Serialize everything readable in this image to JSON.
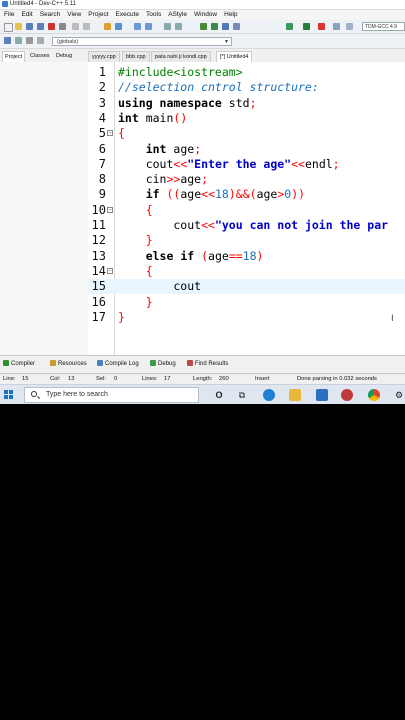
{
  "window": {
    "title": "Untitled4 - Dev-C++ 5.11"
  },
  "menu": [
    "File",
    "Edit",
    "Search",
    "View",
    "Project",
    "Execute",
    "Tools",
    "AStyle",
    "Window",
    "Help"
  ],
  "toolbar": {
    "compiler": "TDM-GCC 4.9",
    "globals": "(globals)"
  },
  "panel_tabs": [
    "Project",
    "Classes",
    "Debug"
  ],
  "file_tabs": [
    "yyyyy.cpp",
    "bbb.cpp",
    "pata nahi ji kondi.cpp",
    "[*] Untitled4"
  ],
  "active_file_tab": 3,
  "code": {
    "current_line": 15,
    "lines": [
      {
        "n": "1",
        "fold": "",
        "tokens": [
          [
            "pp",
            "#include<iostream>"
          ]
        ]
      },
      {
        "n": "2",
        "fold": "",
        "tokens": [
          [
            "cm",
            "//selection cntrol structure:"
          ]
        ]
      },
      {
        "n": "3",
        "fold": "",
        "tokens": [
          [
            "kw",
            "using namespace"
          ],
          [
            "",
            " std"
          ],
          [
            "op",
            ";"
          ]
        ]
      },
      {
        "n": "4",
        "fold": "",
        "tokens": [
          [
            "kw",
            "int"
          ],
          [
            "",
            " main"
          ],
          [
            "op",
            "()"
          ]
        ]
      },
      {
        "n": "5",
        "fold": "-",
        "tokens": [
          [
            "br",
            "{"
          ]
        ]
      },
      {
        "n": "6",
        "fold": "",
        "tokens": [
          [
            "",
            "    "
          ],
          [
            "kw",
            "int"
          ],
          [
            "",
            " age"
          ],
          [
            "op",
            ";"
          ]
        ]
      },
      {
        "n": "7",
        "fold": "",
        "tokens": [
          [
            "",
            "    cout"
          ],
          [
            "op",
            "<<"
          ],
          [
            "str",
            "\"Enter the age\""
          ],
          [
            "op",
            "<<"
          ],
          [
            "",
            "endl"
          ],
          [
            "op",
            ";"
          ]
        ]
      },
      {
        "n": "8",
        "fold": "",
        "tokens": [
          [
            "",
            "    cin"
          ],
          [
            "op",
            ">>"
          ],
          [
            "",
            "age"
          ],
          [
            "op",
            ";"
          ]
        ]
      },
      {
        "n": "9",
        "fold": "",
        "tokens": [
          [
            "",
            "    "
          ],
          [
            "kw",
            "if"
          ],
          [
            "",
            " "
          ],
          [
            "op",
            "(("
          ],
          [
            "",
            "age"
          ],
          [
            "op",
            "<<"
          ],
          [
            "num",
            "18"
          ],
          [
            "op",
            ")&&("
          ],
          [
            "",
            "age"
          ],
          [
            "op",
            ">"
          ],
          [
            "num",
            "0"
          ],
          [
            "op",
            "))"
          ]
        ]
      },
      {
        "n": "10",
        "fold": "-",
        "tokens": [
          [
            "",
            "    "
          ],
          [
            "br",
            "{"
          ]
        ]
      },
      {
        "n": "11",
        "fold": "",
        "tokens": [
          [
            "",
            "        cout"
          ],
          [
            "op",
            "<<"
          ],
          [
            "str",
            "\"you can not join the par"
          ]
        ]
      },
      {
        "n": "12",
        "fold": "",
        "tokens": [
          [
            "",
            "    "
          ],
          [
            "br",
            "}"
          ]
        ]
      },
      {
        "n": "13",
        "fold": "",
        "tokens": [
          [
            "",
            "    "
          ],
          [
            "kw",
            "else if"
          ],
          [
            "",
            " "
          ],
          [
            "op",
            "("
          ],
          [
            "",
            "age"
          ],
          [
            "op",
            "=="
          ],
          [
            "num",
            "18"
          ],
          [
            "op",
            ")"
          ]
        ]
      },
      {
        "n": "14",
        "fold": "-",
        "tokens": [
          [
            "",
            "    "
          ],
          [
            "br",
            "{"
          ]
        ]
      },
      {
        "n": "15",
        "fold": "",
        "tokens": [
          [
            "",
            "        cout"
          ]
        ]
      },
      {
        "n": "16",
        "fold": "",
        "tokens": [
          [
            "",
            "    "
          ],
          [
            "br",
            "}"
          ]
        ]
      },
      {
        "n": "17",
        "fold": "",
        "tokens": [
          [
            "br",
            "}"
          ]
        ]
      }
    ]
  },
  "bottom_tabs": [
    {
      "label": "Compiler",
      "icon": "compiler-icon",
      "color": "#2f8f2f"
    },
    {
      "label": "Resources",
      "icon": "resources-icon",
      "color": "#c99b2c"
    },
    {
      "label": "Compile Log",
      "icon": "compile-log-icon",
      "color": "#4a7fc1"
    },
    {
      "label": "Debug",
      "icon": "debug-icon",
      "color": "#3d9b48"
    },
    {
      "label": "Find Results",
      "icon": "find-results-icon",
      "color": "#b94a48"
    }
  ],
  "status": {
    "line_label": "Line:",
    "line": "15",
    "col_label": "Col:",
    "col": "13",
    "sel_label": "Sel:",
    "sel": "0",
    "lines_label": "Lines:",
    "lines": "17",
    "length_label": "Length:",
    "length": "260",
    "mode": "Insert",
    "message": "Done parsing in 0.032 seconds"
  },
  "taskbar": {
    "search_placeholder": "Type here to search",
    "icons": [
      "cortana-icon",
      "task-view-icon",
      "edge-icon",
      "file-explorer-icon",
      "mail-icon",
      "app-icon",
      "chrome-icon",
      "settings-icon"
    ]
  }
}
